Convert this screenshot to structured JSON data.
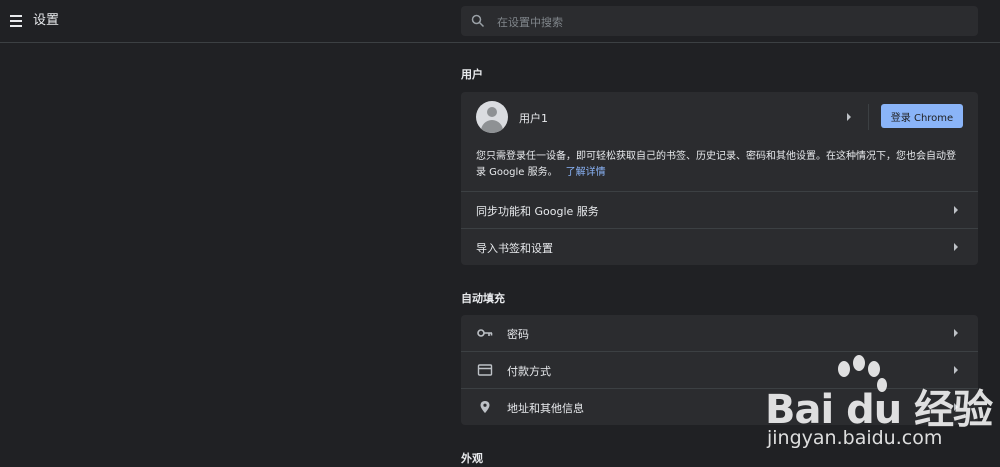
{
  "header": {
    "title": "设置",
    "menu_icon": "hamburger-menu-icon",
    "search_placeholder": "在设置中搜索",
    "search_icon": "search-icon"
  },
  "sections": {
    "people": {
      "title": "用户",
      "profile_name": "用户1",
      "signin_label": "登录 Chrome",
      "description": "您只需登录任一设备，即可轻松获取自己的书签、历史记录、密码和其他设置。在这种情况下，您也会自动登录 Google 服务。",
      "learn_more": "了解详情",
      "rows": [
        {
          "label": "同步功能和 Google 服务"
        },
        {
          "label": "导入书签和设置"
        }
      ]
    },
    "autofill": {
      "title": "自动填充",
      "rows": [
        {
          "label": "密码",
          "icon": "key-icon"
        },
        {
          "label": "付款方式",
          "icon": "credit-card-icon"
        },
        {
          "label": "地址和其他信息",
          "icon": "location-pin-icon"
        }
      ]
    },
    "appearance": {
      "title": "外观"
    }
  },
  "watermark": {
    "brand": "Bai du 经验",
    "url": "jingyan.baidu.com"
  },
  "colors": {
    "background": "#202124",
    "card": "#2b2c2f",
    "accent": "#8ab4f8",
    "divider": "#3c4043"
  }
}
